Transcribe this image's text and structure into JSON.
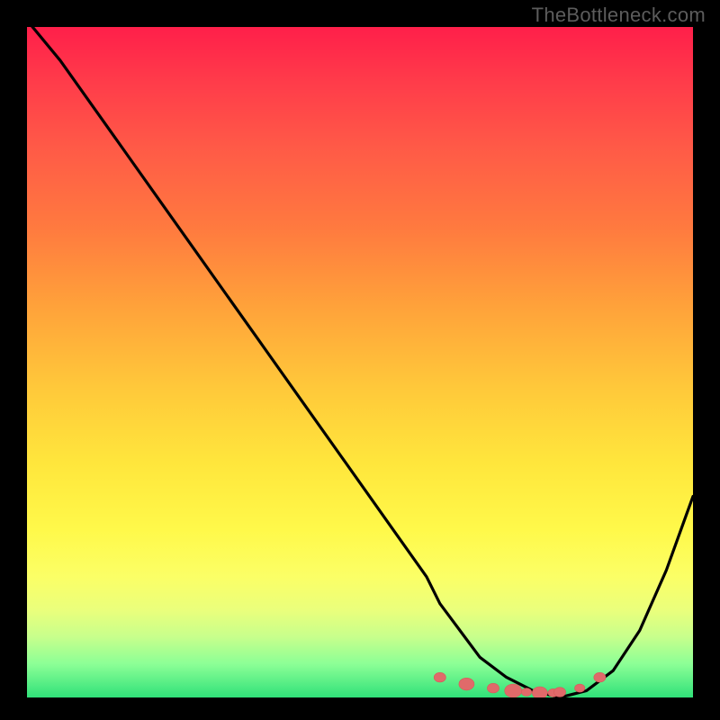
{
  "watermark": "TheBottleneck.com",
  "colors": {
    "background": "#000000",
    "curve": "#000000",
    "marker_fill": "#e06a6a",
    "marker_stroke": "#d85a5a"
  },
  "chart_data": {
    "type": "line",
    "title": "",
    "xlabel": "",
    "ylabel": "",
    "xlim": [
      0,
      100
    ],
    "ylim": [
      0,
      100
    ],
    "series": [
      {
        "name": "bottleneck-curve",
        "x": [
          0,
          5,
          10,
          15,
          20,
          25,
          30,
          35,
          40,
          45,
          50,
          55,
          60,
          62,
          65,
          68,
          72,
          76,
          80,
          84,
          88,
          92,
          96,
          100
        ],
        "values": [
          101,
          95,
          88,
          81,
          74,
          67,
          60,
          53,
          46,
          39,
          32,
          25,
          18,
          14,
          10,
          6,
          3,
          1,
          0,
          1,
          4,
          10,
          19,
          30
        ]
      }
    ],
    "markers": {
      "name": "optimal-range",
      "x": [
        62,
        66,
        70,
        73,
        75,
        77,
        79,
        80,
        83,
        86
      ],
      "values": [
        3.0,
        2.0,
        1.4,
        1.0,
        0.8,
        0.7,
        0.7,
        0.8,
        1.4,
        3.0
      ],
      "size": [
        7,
        9,
        7,
        10,
        6,
        9,
        6,
        7,
        6,
        7
      ]
    }
  }
}
